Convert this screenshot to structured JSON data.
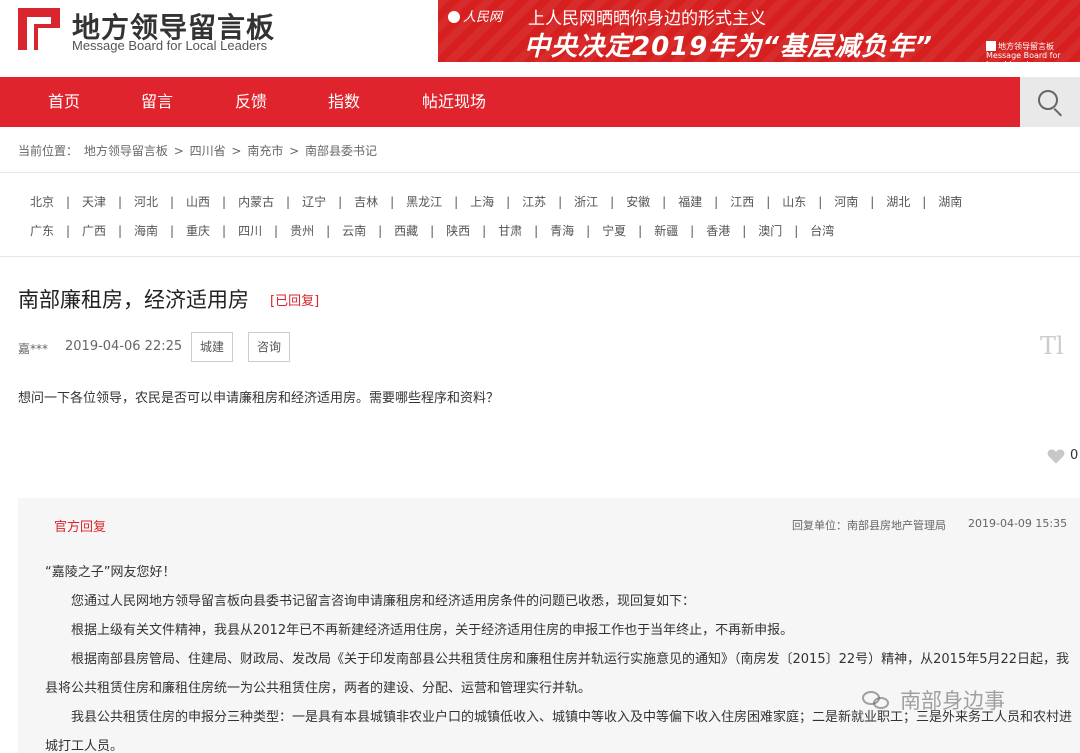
{
  "site": {
    "title_cn": "地方领导留言板",
    "title_en": "Message Board for Local Leaders"
  },
  "banner": {
    "logo": "人民网",
    "top_line": "上人民网晒晒你身边的形式主义",
    "main_line": "中央决定2019年为“基层减负年”",
    "mini_1": "地方领导留言板",
    "mini_2": "Message Board for Local Leaders"
  },
  "nav": {
    "items": [
      {
        "label": "首页"
      },
      {
        "label": "留言"
      },
      {
        "label": "反馈"
      },
      {
        "label": "指数"
      },
      {
        "label": "帖近现场"
      }
    ],
    "search_icon": "search-icon"
  },
  "breadcrumb": {
    "prefix": "当前位置：",
    "items": [
      "地方领导留言板",
      "四川省",
      "南充市",
      "南部县委书记"
    ],
    "separator": ">"
  },
  "provinces": {
    "row1": [
      "北京",
      "天津",
      "河北",
      "山西",
      "内蒙古",
      "辽宁",
      "吉林",
      "黑龙江",
      "上海",
      "江苏",
      "浙江",
      "安徽",
      "福建",
      "江西",
      "山东",
      "河南",
      "湖北",
      "湖南"
    ],
    "row2": [
      "广东",
      "广西",
      "海南",
      "重庆",
      "四川",
      "贵州",
      "云南",
      "西藏",
      "陕西",
      "甘肃",
      "青海",
      "宁夏",
      "新疆",
      "香港",
      "澳门",
      "台湾"
    ],
    "separator": "|"
  },
  "question": {
    "title": "南部廉租房，经济适用房",
    "status": "[已回复]",
    "user": "嘉***",
    "date": "2019-04-06 22:25",
    "tags": [
      "城建",
      "咨询"
    ],
    "font_icon": "Tl",
    "body": "想问一下各位领导，农民是否可以申请廉租房和经济适用房。需要哪些程序和资料？",
    "likes": "0"
  },
  "reply": {
    "label": "官方回复",
    "unit": "回复单位：南部县房地产管理局",
    "date": "2019-04-09 15:35",
    "paragraphs": [
      "“嘉陵之子”网友您好！",
      "　　您通过人民网地方领导留言板向县委书记留言咨询申请廉租房和经济适用房条件的问题已收悉，现回复如下：",
      "　　根据上级有关文件精神，我县从2012年已不再新建经济适用住房，关于经济适用住房的申报工作也于当年终止，不再新申报。",
      "　　根据南部县房管局、住建局、财政局、发改局《关于印发南部县公共租赁住房和廉租住房并轨运行实施意见的通知》（南房发〔2015〕22号）精神，从2015年5月22日起，我县将公共租赁住房和廉租住房统一为公共租赁住房，两者的建设、分配、运营和管理实行并轨。",
      "　　我县公共租赁住房的申报分三种类型：一是具有本县城镇非农业户口的城镇低收入、城镇中等收入及中等偏下收入住房困难家庭；二是新就业职工；三是外来务工人员和农村进城打工人员。"
    ]
  },
  "watermark": {
    "text": "南部身边事"
  },
  "colors": {
    "brand_red": "#e0242e",
    "status_red": "#d9262e",
    "reply_bg": "#f6f6f6"
  }
}
